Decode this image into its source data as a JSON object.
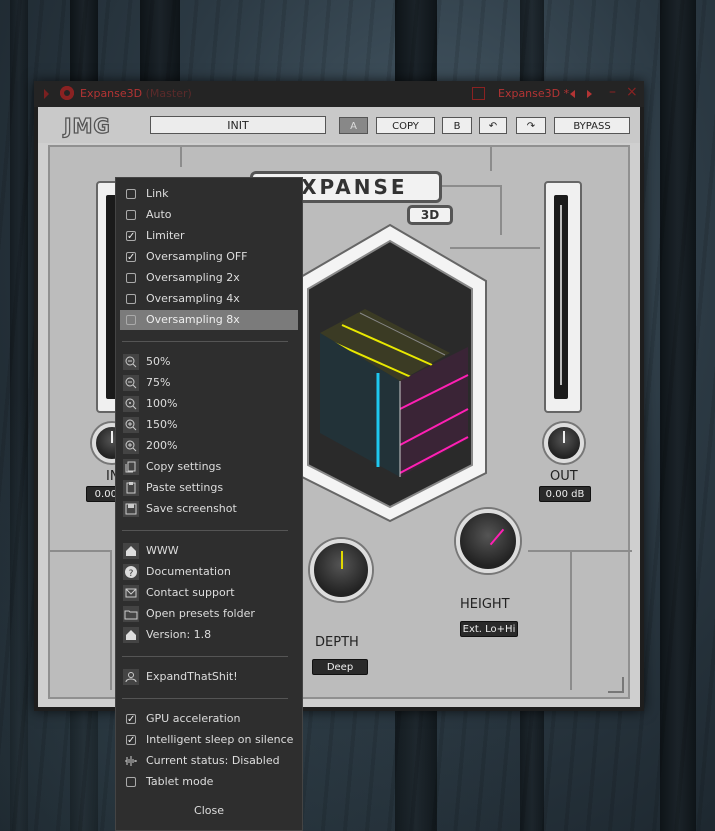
{
  "window": {
    "title": "Expanse3D",
    "title_suffix": "(Master)",
    "preset_name": "Expanse3D *",
    "accent_color": "#b33434"
  },
  "toolbar": {
    "logo": "JMG",
    "preset": "INIT",
    "a_label": "A",
    "copy_label": "COPY",
    "b_label": "B",
    "bypass_label": "BYPASS"
  },
  "plugin": {
    "title": "EXPANSE",
    "badge": "3D",
    "in_label": "IN",
    "in_value": "0.00 dB",
    "out_label": "OUT",
    "out_value": "0.00 dB",
    "depth_label": "DEPTH",
    "depth_mode": "Deep",
    "height_label": "HEIGHT",
    "height_mode": "Ext. Lo+Hi"
  },
  "menu": {
    "options": [
      {
        "label": "Link",
        "checked": false
      },
      {
        "label": "Auto",
        "checked": false
      },
      {
        "label": "Limiter",
        "checked": true
      },
      {
        "label": "Oversampling OFF",
        "checked": true
      },
      {
        "label": "Oversampling 2x",
        "checked": false
      },
      {
        "label": "Oversampling 4x",
        "checked": false
      },
      {
        "label": "Oversampling 8x",
        "checked": false,
        "highlighted": true
      }
    ],
    "zoom": [
      "50%",
      "75%",
      "100%",
      "150%",
      "200%"
    ],
    "settings": [
      "Copy settings",
      "Paste settings",
      "Save screenshot"
    ],
    "links": [
      "WWW",
      "Documentation",
      "Contact support",
      "Open presets folder",
      "Version: 1.8"
    ],
    "user": "ExpandThatShit!",
    "system": [
      {
        "label": "GPU acceleration",
        "checked": true
      },
      {
        "label": "Intelligent sleep on silence",
        "checked": true
      },
      {
        "label": "Current status: Disabled",
        "checked": null
      },
      {
        "label": "Tablet mode",
        "checked": false
      }
    ],
    "close": "Close"
  }
}
